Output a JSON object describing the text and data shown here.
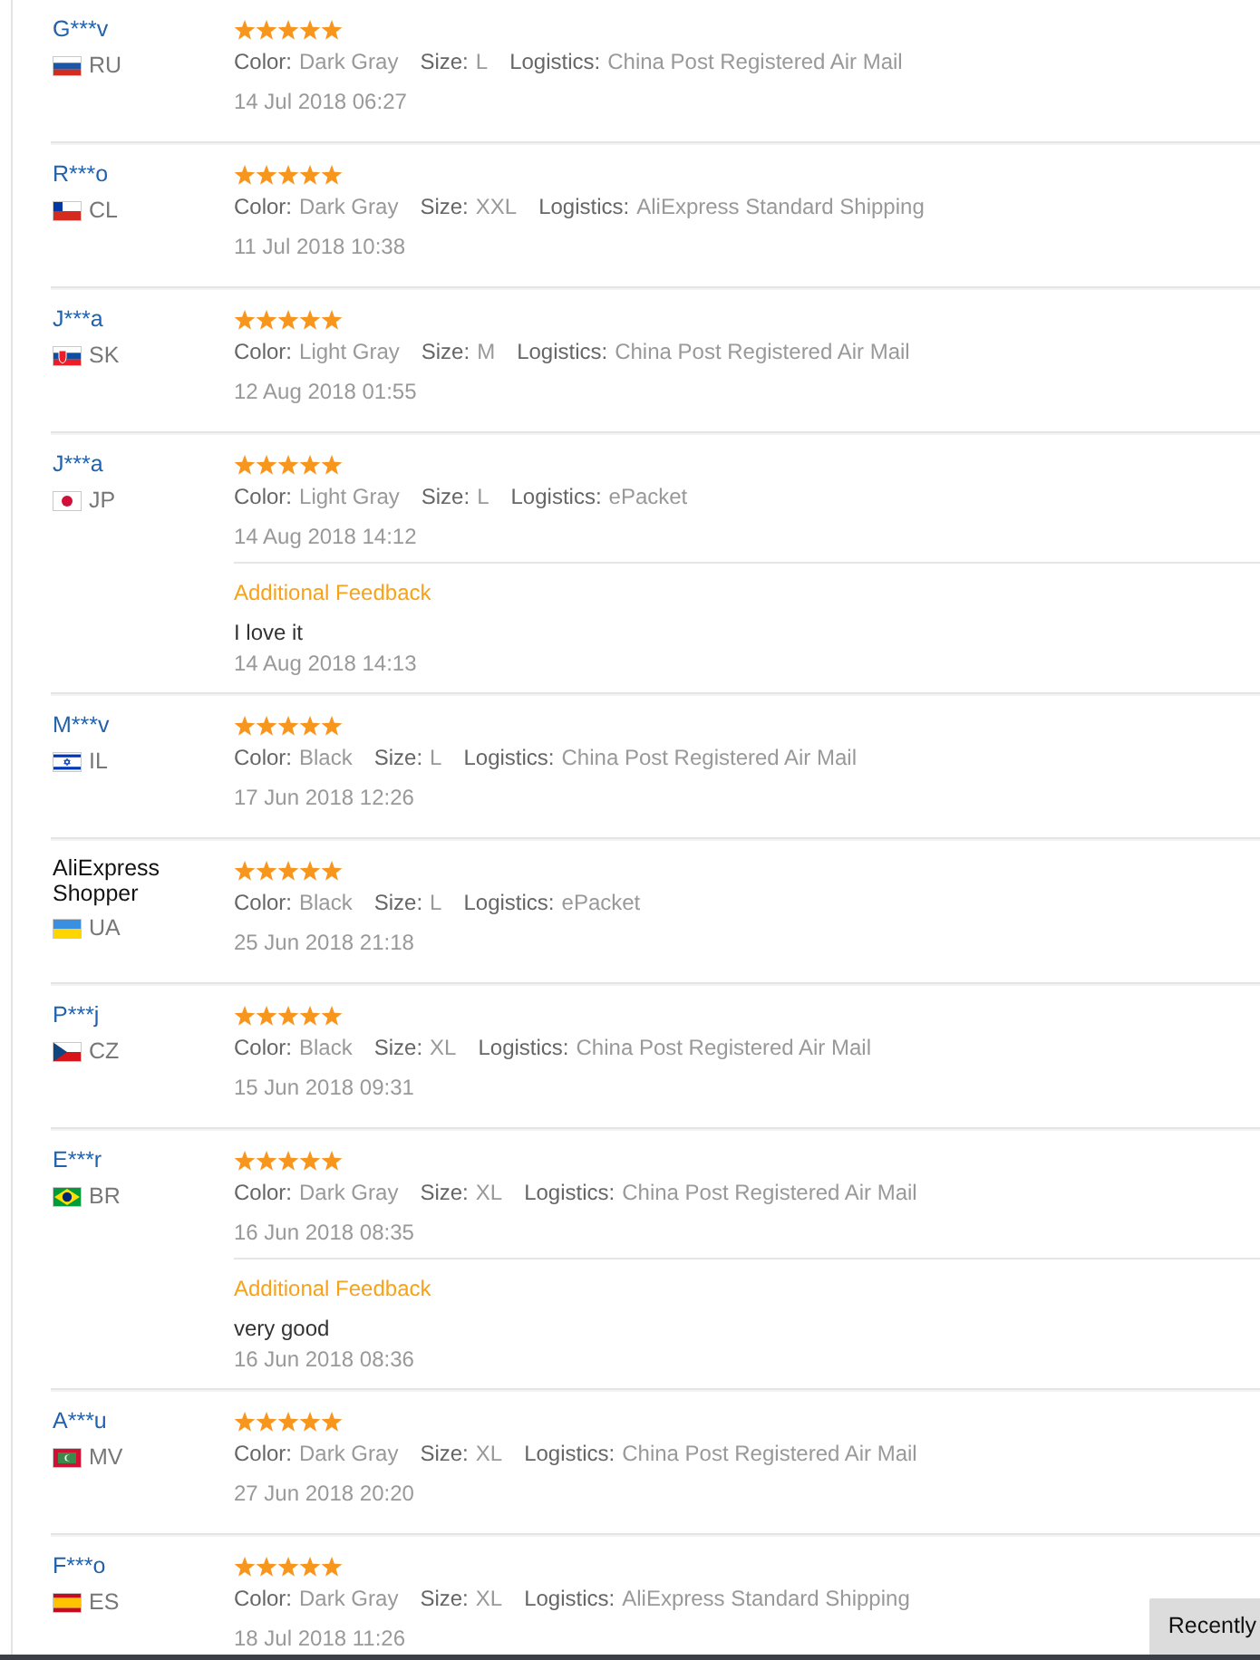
{
  "reviews": [
    {
      "name": "G***v",
      "link": true,
      "country": "RU",
      "flag": {
        "kind": "russia"
      },
      "stars": 5,
      "attributes": [
        {
          "label": "Color:",
          "value": "Dark Gray"
        },
        {
          "label": "Size:",
          "value": "L"
        },
        {
          "label": "Logistics:",
          "value": "China Post Registered Air Mail"
        }
      ],
      "date": "14 Jul 2018 06:27"
    },
    {
      "name": "R***o",
      "link": true,
      "country": "CL",
      "flag": {
        "kind": "chile"
      },
      "stars": 5,
      "attributes": [
        {
          "label": "Color:",
          "value": "Dark Gray"
        },
        {
          "label": "Size:",
          "value": "XXL"
        },
        {
          "label": "Logistics:",
          "value": "AliExpress Standard Shipping"
        }
      ],
      "date": "11 Jul 2018 10:38"
    },
    {
      "name": "J***a",
      "link": true,
      "country": "SK",
      "flag": {
        "kind": "slovakia"
      },
      "stars": 5,
      "attributes": [
        {
          "label": "Color:",
          "value": "Light Gray"
        },
        {
          "label": "Size:",
          "value": "M"
        },
        {
          "label": "Logistics:",
          "value": "China Post Registered Air Mail"
        }
      ],
      "date": "12 Aug 2018 01:55"
    },
    {
      "name": "J***a",
      "link": true,
      "country": "JP",
      "flag": {
        "kind": "japan"
      },
      "stars": 5,
      "attributes": [
        {
          "label": "Color:",
          "value": "Light Gray"
        },
        {
          "label": "Size:",
          "value": "L"
        },
        {
          "label": "Logistics:",
          "value": "ePacket"
        }
      ],
      "date": "14 Aug 2018 14:12",
      "additional_feedback": {
        "title": "Additional Feedback",
        "text": "I love it",
        "date": "14 Aug 2018 14:13"
      }
    },
    {
      "name": "M***v",
      "link": true,
      "country": "IL",
      "flag": {
        "kind": "israel"
      },
      "stars": 5,
      "attributes": [
        {
          "label": "Color:",
          "value": "Black"
        },
        {
          "label": "Size:",
          "value": "L"
        },
        {
          "label": "Logistics:",
          "value": "China Post Registered Air Mail"
        }
      ],
      "date": "17 Jun 2018 12:26"
    },
    {
      "name": "AliExpress Shopper",
      "link": false,
      "country": "UA",
      "flag": {
        "kind": "ukraine"
      },
      "stars": 5,
      "attributes": [
        {
          "label": "Color:",
          "value": "Black"
        },
        {
          "label": "Size:",
          "value": "L"
        },
        {
          "label": "Logistics:",
          "value": "ePacket"
        }
      ],
      "date": "25 Jun 2018 21:18"
    },
    {
      "name": "P***j",
      "link": true,
      "country": "CZ",
      "flag": {
        "kind": "czechia"
      },
      "stars": 5,
      "attributes": [
        {
          "label": "Color:",
          "value": "Black"
        },
        {
          "label": "Size:",
          "value": "XL"
        },
        {
          "label": "Logistics:",
          "value": "China Post Registered Air Mail"
        }
      ],
      "date": "15 Jun 2018 09:31"
    },
    {
      "name": "E***r",
      "link": true,
      "country": "BR",
      "flag": {
        "kind": "brazil"
      },
      "stars": 5,
      "attributes": [
        {
          "label": "Color:",
          "value": "Dark Gray"
        },
        {
          "label": "Size:",
          "value": "XL"
        },
        {
          "label": "Logistics:",
          "value": "China Post Registered Air Mail"
        }
      ],
      "date": "16 Jun 2018 08:35",
      "additional_feedback": {
        "title": "Additional Feedback",
        "text": "very good",
        "date": "16 Jun 2018 08:36"
      }
    },
    {
      "name": "A***u",
      "link": true,
      "country": "MV",
      "flag": {
        "kind": "maldives"
      },
      "stars": 5,
      "attributes": [
        {
          "label": "Color:",
          "value": "Dark Gray"
        },
        {
          "label": "Size:",
          "value": "XL"
        },
        {
          "label": "Logistics:",
          "value": "China Post Registered Air Mail"
        }
      ],
      "date": "27 Jun 2018 20:20"
    },
    {
      "name": "F***o",
      "link": true,
      "country": "ES",
      "flag": {
        "kind": "spain"
      },
      "stars": 5,
      "attributes": [
        {
          "label": "Color:",
          "value": "Dark Gray"
        },
        {
          "label": "Size:",
          "value": "XL"
        },
        {
          "label": "Logistics:",
          "value": "AliExpress Standard Shipping"
        }
      ],
      "date": "18 Jul 2018 11:26"
    }
  ],
  "recently_tab": {
    "label": "Recently"
  }
}
